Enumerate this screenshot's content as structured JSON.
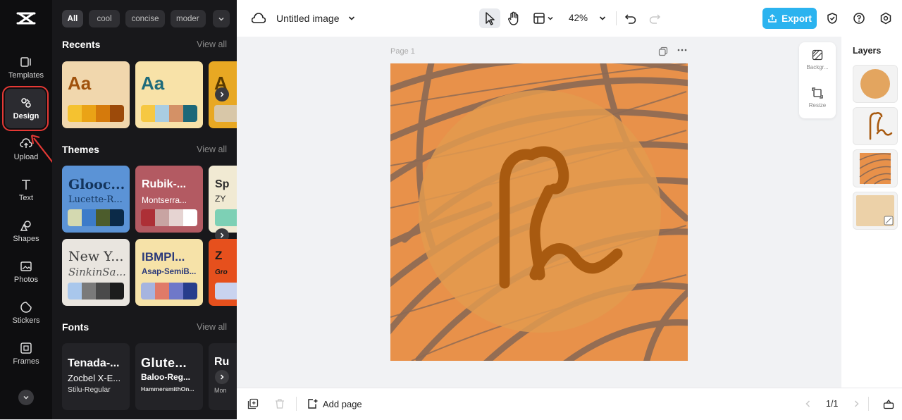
{
  "rail": {
    "items": [
      {
        "label": "Templates",
        "icon": "templates-icon"
      },
      {
        "label": "Design",
        "icon": "design-icon"
      },
      {
        "label": "Upload",
        "icon": "upload-icon"
      },
      {
        "label": "Text",
        "icon": "text-icon"
      },
      {
        "label": "Shapes",
        "icon": "shapes-icon"
      },
      {
        "label": "Photos",
        "icon": "photos-icon"
      },
      {
        "label": "Stickers",
        "icon": "stickers-icon"
      },
      {
        "label": "Frames",
        "icon": "frames-icon"
      }
    ]
  },
  "panel": {
    "chips": [
      "All",
      "cool",
      "concise",
      "moder"
    ],
    "recents": {
      "title": "Recents",
      "view_all": "View all",
      "cards": [
        {
          "sample": "Aa",
          "bg": "#f1d7ad",
          "text_color": "#a0520d",
          "swatches": [
            "#f5c230",
            "#eaa316",
            "#d57a0c",
            "#9c4a0a"
          ]
        },
        {
          "sample": "Aa",
          "bg": "#f8e2a8",
          "text_color": "#1e6b7b",
          "swatches": [
            "#f6c842",
            "#a9cde2",
            "#d49166",
            "#1d6879"
          ]
        },
        {
          "sample": "A",
          "bg": "#e8a823",
          "text_color": "#5a3b00",
          "swatches": [
            "#d8c7a8"
          ]
        }
      ]
    },
    "themes": {
      "title": "Themes",
      "view_all": "View all",
      "cards": [
        {
          "heading": "Glooc...",
          "sub": "Lucette-R...",
          "bg": "#5b93d6",
          "text_color": "#13345c",
          "swatches": [
            "#d4d9b0",
            "#3c7bc9",
            "#4c5c2c",
            "#0b2a48"
          ]
        },
        {
          "heading": "Rubik-...",
          "sub": "Montserra...",
          "bg": "#b35a62",
          "text_color": "#ffffff",
          "swatches": [
            "#ad2f36",
            "#c8a4a2",
            "#e6d4d2",
            "#ffffff"
          ]
        },
        {
          "heading": "Sp",
          "sub": "ZY",
          "bg": "#f1ead3",
          "text_color": "#2c2c2c",
          "swatches": [
            "#7dd0b5"
          ]
        },
        {
          "heading": "New Y...",
          "sub": "SinkinSa...",
          "bg": "#e9e5df",
          "text_color": "#3b3b3b",
          "swatches": [
            "#a9c7ec",
            "#7a7a7a",
            "#4a4a4a",
            "#1c1c1c"
          ]
        },
        {
          "heading": "IBMPl...",
          "sub": "Asap-SemiB...",
          "bg": "#f6e2a8",
          "text_color": "#2c3a7a",
          "swatches": [
            "#a6b4df",
            "#e07a68",
            "#6f78c9",
            "#283d8c"
          ]
        },
        {
          "heading": "Z",
          "sub": "Gro",
          "bg": "#e6501d",
          "text_color": "#1a1a1a",
          "swatches": [
            "#c9d3ef"
          ]
        }
      ]
    },
    "fonts": {
      "title": "Fonts",
      "view_all": "View all",
      "cards": [
        {
          "line1": "Tenada-...",
          "line2": "Zocbel X-E...",
          "line3": "Stilu-Regular"
        },
        {
          "line1": "Glute...",
          "line2": "Baloo-Reg...",
          "line3": "HammersmithOn..."
        },
        {
          "line1": "Ru",
          "line2": "",
          "line3": "Mon"
        }
      ]
    }
  },
  "topbar": {
    "title": "Untitled image",
    "zoom": "42%",
    "export_label": "Export"
  },
  "canvas": {
    "page_label": "Page 1",
    "bg_color": "#e8914a",
    "circle_color": "#e39b4e",
    "stroke_color": "#8c6a55",
    "glyph_color": "#a85a10"
  },
  "floating_tools": [
    {
      "label": "Backgr...",
      "icon": "background-icon"
    },
    {
      "label": "Resize",
      "icon": "resize-icon"
    }
  ],
  "layers": {
    "title": "Layers",
    "items": [
      "circle-layer",
      "glyph-layer",
      "pattern-layer",
      "background-layer"
    ]
  },
  "bottombar": {
    "add_page_label": "Add page",
    "page_indicator": "1/1"
  }
}
